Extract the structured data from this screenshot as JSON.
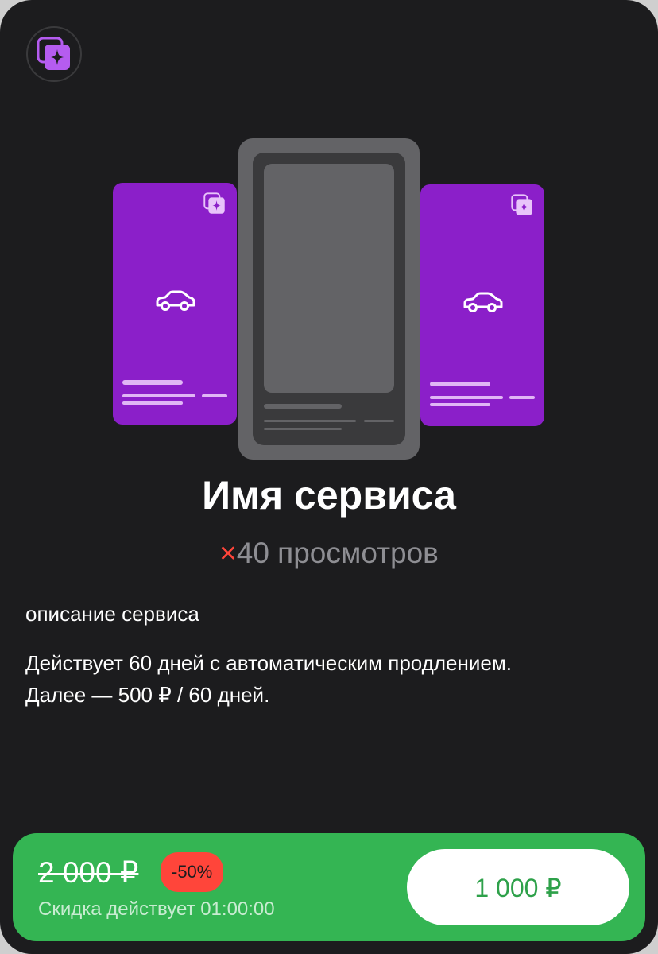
{
  "app": {
    "icon": "stacked-cards-sparkle-icon",
    "accent_color": "#8b1fc9"
  },
  "illustration": {
    "side_card_icon": "car-icon",
    "card_color": "#8b1fc9",
    "phone_color": "#636366"
  },
  "service": {
    "title": "Имя сервиса",
    "views_multiplier": "×",
    "views_text": "40 просмотров",
    "description": "описание сервиса",
    "terms_line1": "Действует 60 дней с автоматическим продлением.",
    "terms_line2": "Далее — 500 ₽ / 60 дней."
  },
  "purchase": {
    "old_price": "2 000 ₽",
    "discount_badge": "-50%",
    "timer_text": "Скидка действует 01:00:00",
    "button_label": "1 000 ₽",
    "bar_color": "#34b553",
    "badge_color": "#ff453a"
  }
}
